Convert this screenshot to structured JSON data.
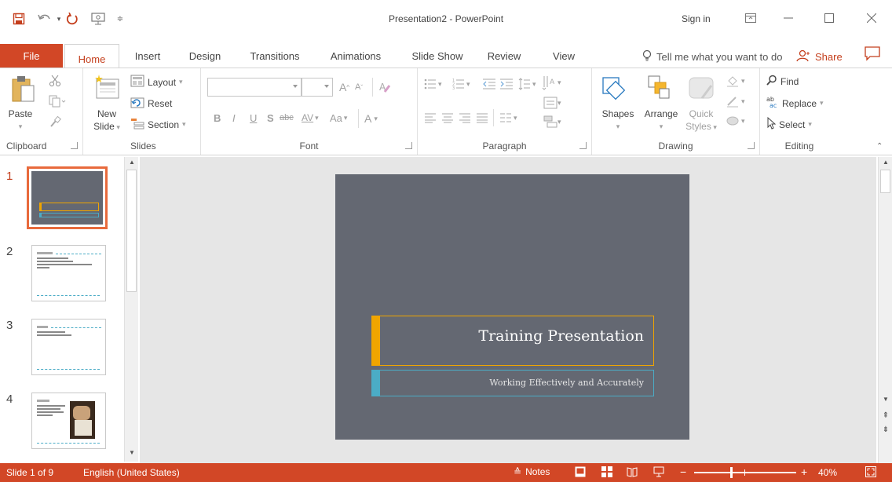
{
  "window": {
    "title": "Presentation2 - PowerPoint",
    "sign_in": "Sign in"
  },
  "tabs": {
    "file": "File",
    "items": [
      "Home",
      "Insert",
      "Design",
      "Transitions",
      "Animations",
      "Slide Show",
      "Review",
      "View"
    ],
    "active": "Home",
    "tell_me": "Tell me what you want to do",
    "share": "Share"
  },
  "ribbon": {
    "clipboard": {
      "label": "Clipboard",
      "paste": "Paste"
    },
    "slides": {
      "label": "Slides",
      "new_slide_line1": "New",
      "new_slide_line2": "Slide",
      "layout": "Layout",
      "reset": "Reset",
      "section": "Section"
    },
    "font": {
      "label": "Font",
      "bold": "B",
      "italic": "I",
      "underline": "U",
      "shadow": "S",
      "strike": "abc",
      "spacing": "AV",
      "case": "Aa",
      "color": "A",
      "grow": "A",
      "shrink": "A"
    },
    "paragraph": {
      "label": "Paragraph"
    },
    "drawing": {
      "label": "Drawing",
      "shapes": "Shapes",
      "arrange": "Arrange",
      "quick_styles_line1": "Quick",
      "quick_styles_line2": "Styles"
    },
    "editing": {
      "label": "Editing",
      "find": "Find",
      "replace": "Replace",
      "select": "Select"
    }
  },
  "thumbnails": [
    {
      "number": "1",
      "selected": true
    },
    {
      "number": "2",
      "selected": false
    },
    {
      "number": "3",
      "selected": false
    },
    {
      "number": "4",
      "selected": false
    }
  ],
  "slide": {
    "title": "Training Presentation",
    "subtitle": "Working Effectively and Accurately",
    "background": "#646872",
    "title_accent": "#f0a500",
    "subtitle_accent": "#4bacc6"
  },
  "status": {
    "slide_info": "Slide 1 of 9",
    "language": "English (United States)",
    "notes": "Notes",
    "zoom": "40%"
  },
  "colors": {
    "accent": "#d24726",
    "accent_text": "#c43e1c"
  }
}
